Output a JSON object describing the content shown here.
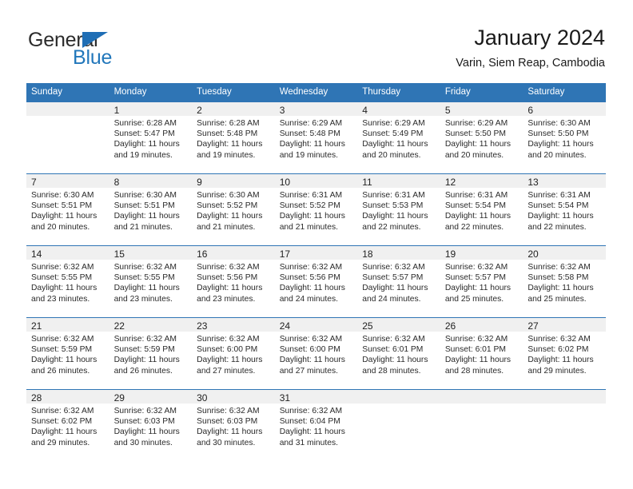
{
  "brand": {
    "name_part1": "General",
    "name_part2": "Blue",
    "triangle_color": "#1f6eb5",
    "blue_text_color": "#2277bb"
  },
  "header": {
    "title": "January 2024",
    "subtitle": "Varin, Siem Reap, Cambodia"
  },
  "theme": {
    "header_blue": "#2f75b5",
    "daynum_band_gray": "#f0f0f0",
    "text_color": "#2a2a2a"
  },
  "weekday_headers": [
    "Sunday",
    "Monday",
    "Tuesday",
    "Wednesday",
    "Thursday",
    "Friday",
    "Saturday"
  ],
  "weeks": [
    [
      {
        "day": "",
        "sunrise": "",
        "sunset": "",
        "daylight1": "",
        "daylight2": ""
      },
      {
        "day": "1",
        "sunrise": "Sunrise: 6:28 AM",
        "sunset": "Sunset: 5:47 PM",
        "daylight1": "Daylight: 11 hours",
        "daylight2": "and 19 minutes."
      },
      {
        "day": "2",
        "sunrise": "Sunrise: 6:28 AM",
        "sunset": "Sunset: 5:48 PM",
        "daylight1": "Daylight: 11 hours",
        "daylight2": "and 19 minutes."
      },
      {
        "day": "3",
        "sunrise": "Sunrise: 6:29 AM",
        "sunset": "Sunset: 5:48 PM",
        "daylight1": "Daylight: 11 hours",
        "daylight2": "and 19 minutes."
      },
      {
        "day": "4",
        "sunrise": "Sunrise: 6:29 AM",
        "sunset": "Sunset: 5:49 PM",
        "daylight1": "Daylight: 11 hours",
        "daylight2": "and 20 minutes."
      },
      {
        "day": "5",
        "sunrise": "Sunrise: 6:29 AM",
        "sunset": "Sunset: 5:50 PM",
        "daylight1": "Daylight: 11 hours",
        "daylight2": "and 20 minutes."
      },
      {
        "day": "6",
        "sunrise": "Sunrise: 6:30 AM",
        "sunset": "Sunset: 5:50 PM",
        "daylight1": "Daylight: 11 hours",
        "daylight2": "and 20 minutes."
      }
    ],
    [
      {
        "day": "7",
        "sunrise": "Sunrise: 6:30 AM",
        "sunset": "Sunset: 5:51 PM",
        "daylight1": "Daylight: 11 hours",
        "daylight2": "and 20 minutes."
      },
      {
        "day": "8",
        "sunrise": "Sunrise: 6:30 AM",
        "sunset": "Sunset: 5:51 PM",
        "daylight1": "Daylight: 11 hours",
        "daylight2": "and 21 minutes."
      },
      {
        "day": "9",
        "sunrise": "Sunrise: 6:30 AM",
        "sunset": "Sunset: 5:52 PM",
        "daylight1": "Daylight: 11 hours",
        "daylight2": "and 21 minutes."
      },
      {
        "day": "10",
        "sunrise": "Sunrise: 6:31 AM",
        "sunset": "Sunset: 5:52 PM",
        "daylight1": "Daylight: 11 hours",
        "daylight2": "and 21 minutes."
      },
      {
        "day": "11",
        "sunrise": "Sunrise: 6:31 AM",
        "sunset": "Sunset: 5:53 PM",
        "daylight1": "Daylight: 11 hours",
        "daylight2": "and 22 minutes."
      },
      {
        "day": "12",
        "sunrise": "Sunrise: 6:31 AM",
        "sunset": "Sunset: 5:54 PM",
        "daylight1": "Daylight: 11 hours",
        "daylight2": "and 22 minutes."
      },
      {
        "day": "13",
        "sunrise": "Sunrise: 6:31 AM",
        "sunset": "Sunset: 5:54 PM",
        "daylight1": "Daylight: 11 hours",
        "daylight2": "and 22 minutes."
      }
    ],
    [
      {
        "day": "14",
        "sunrise": "Sunrise: 6:32 AM",
        "sunset": "Sunset: 5:55 PM",
        "daylight1": "Daylight: 11 hours",
        "daylight2": "and 23 minutes."
      },
      {
        "day": "15",
        "sunrise": "Sunrise: 6:32 AM",
        "sunset": "Sunset: 5:55 PM",
        "daylight1": "Daylight: 11 hours",
        "daylight2": "and 23 minutes."
      },
      {
        "day": "16",
        "sunrise": "Sunrise: 6:32 AM",
        "sunset": "Sunset: 5:56 PM",
        "daylight1": "Daylight: 11 hours",
        "daylight2": "and 23 minutes."
      },
      {
        "day": "17",
        "sunrise": "Sunrise: 6:32 AM",
        "sunset": "Sunset: 5:56 PM",
        "daylight1": "Daylight: 11 hours",
        "daylight2": "and 24 minutes."
      },
      {
        "day": "18",
        "sunrise": "Sunrise: 6:32 AM",
        "sunset": "Sunset: 5:57 PM",
        "daylight1": "Daylight: 11 hours",
        "daylight2": "and 24 minutes."
      },
      {
        "day": "19",
        "sunrise": "Sunrise: 6:32 AM",
        "sunset": "Sunset: 5:57 PM",
        "daylight1": "Daylight: 11 hours",
        "daylight2": "and 25 minutes."
      },
      {
        "day": "20",
        "sunrise": "Sunrise: 6:32 AM",
        "sunset": "Sunset: 5:58 PM",
        "daylight1": "Daylight: 11 hours",
        "daylight2": "and 25 minutes."
      }
    ],
    [
      {
        "day": "21",
        "sunrise": "Sunrise: 6:32 AM",
        "sunset": "Sunset: 5:59 PM",
        "daylight1": "Daylight: 11 hours",
        "daylight2": "and 26 minutes."
      },
      {
        "day": "22",
        "sunrise": "Sunrise: 6:32 AM",
        "sunset": "Sunset: 5:59 PM",
        "daylight1": "Daylight: 11 hours",
        "daylight2": "and 26 minutes."
      },
      {
        "day": "23",
        "sunrise": "Sunrise: 6:32 AM",
        "sunset": "Sunset: 6:00 PM",
        "daylight1": "Daylight: 11 hours",
        "daylight2": "and 27 minutes."
      },
      {
        "day": "24",
        "sunrise": "Sunrise: 6:32 AM",
        "sunset": "Sunset: 6:00 PM",
        "daylight1": "Daylight: 11 hours",
        "daylight2": "and 27 minutes."
      },
      {
        "day": "25",
        "sunrise": "Sunrise: 6:32 AM",
        "sunset": "Sunset: 6:01 PM",
        "daylight1": "Daylight: 11 hours",
        "daylight2": "and 28 minutes."
      },
      {
        "day": "26",
        "sunrise": "Sunrise: 6:32 AM",
        "sunset": "Sunset: 6:01 PM",
        "daylight1": "Daylight: 11 hours",
        "daylight2": "and 28 minutes."
      },
      {
        "day": "27",
        "sunrise": "Sunrise: 6:32 AM",
        "sunset": "Sunset: 6:02 PM",
        "daylight1": "Daylight: 11 hours",
        "daylight2": "and 29 minutes."
      }
    ],
    [
      {
        "day": "28",
        "sunrise": "Sunrise: 6:32 AM",
        "sunset": "Sunset: 6:02 PM",
        "daylight1": "Daylight: 11 hours",
        "daylight2": "and 29 minutes."
      },
      {
        "day": "29",
        "sunrise": "Sunrise: 6:32 AM",
        "sunset": "Sunset: 6:03 PM",
        "daylight1": "Daylight: 11 hours",
        "daylight2": "and 30 minutes."
      },
      {
        "day": "30",
        "sunrise": "Sunrise: 6:32 AM",
        "sunset": "Sunset: 6:03 PM",
        "daylight1": "Daylight: 11 hours",
        "daylight2": "and 30 minutes."
      },
      {
        "day": "31",
        "sunrise": "Sunrise: 6:32 AM",
        "sunset": "Sunset: 6:04 PM",
        "daylight1": "Daylight: 11 hours",
        "daylight2": "and 31 minutes."
      },
      {
        "day": "",
        "sunrise": "",
        "sunset": "",
        "daylight1": "",
        "daylight2": ""
      },
      {
        "day": "",
        "sunrise": "",
        "sunset": "",
        "daylight1": "",
        "daylight2": ""
      },
      {
        "day": "",
        "sunrise": "",
        "sunset": "",
        "daylight1": "",
        "daylight2": ""
      }
    ]
  ]
}
